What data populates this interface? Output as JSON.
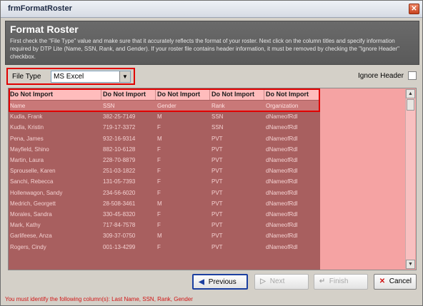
{
  "window": {
    "title": "frmFormatRoster",
    "close_icon": "close-icon"
  },
  "header": {
    "heading": "Format Roster",
    "description": "First check the \"File Type\" value and make sure that it accurately reflects the format of your roster. Next click on the column titles and specify information required by DTP Lite (Name, SSN, Rank, and Gender). If your roster file contains header information, it must be removed by checking the \"Ignore Header\" checkbox."
  },
  "file_type": {
    "label": "File Type",
    "value": "MS Excel"
  },
  "ignore_header": {
    "label": "Ignore Header",
    "checked": false
  },
  "grid": {
    "columns": [
      "Do Not Import",
      "Do Not Import",
      "Do Not Import",
      "Do Not Import",
      "Do Not Import"
    ],
    "rows": [
      [
        "Name",
        "SSN",
        "Gender",
        "Rank",
        "Organization"
      ],
      [
        "Kudla, Frank",
        "382-25-7149",
        "M",
        "SSN",
        "dNameofRdl"
      ],
      [
        "Kudla, Kristin",
        "719-17-3372",
        "F",
        "SSN",
        "dNameofRdl"
      ],
      [
        "Pena, James",
        "932-16-9314",
        "M",
        "PVT",
        "dNameofRdl"
      ],
      [
        "Mayfield, Shino",
        "882-10-6128",
        "F",
        "PVT",
        "dNameofRdl"
      ],
      [
        "Martin, Laura",
        "228-70-8879",
        "F",
        "PVT",
        "dNameofRdl"
      ],
      [
        "Sprouselle, Karen",
        "251-03-1822",
        "F",
        "PVT",
        "dNameofRdl"
      ],
      [
        "Sanchi, Rebecca",
        "131-05-7393",
        "F",
        "PVT",
        "dNameofRdl"
      ],
      [
        "Hollenwagon, Sandy",
        "234-56-6020",
        "F",
        "PVT",
        "dNameofRdl"
      ],
      [
        "Medrich, Georgett",
        "28-508-3461",
        "M",
        "PVT",
        "dNameofRdl"
      ],
      [
        "Morales, Sandra",
        "330-45-8320",
        "F",
        "PVT",
        "dNameofRdl"
      ],
      [
        "Mark, Kathy",
        "717-84-7578",
        "F",
        "PVT",
        "dNameofRdl"
      ],
      [
        "Garlifeese, Anza",
        "309-37-0750",
        "M",
        "PVT",
        "dNameofRdl"
      ],
      [
        "Rogers, Cindy",
        "001-13-4299",
        "F",
        "PVT",
        "dNameofRdl"
      ]
    ]
  },
  "buttons": {
    "previous": "Previous",
    "next": "Next",
    "finish": "Finish",
    "cancel": "Cancel"
  },
  "status": {
    "message": "You must identify the following column(s): Last Name, SSN, Rank, Gender"
  },
  "colors": {
    "grid_bg": "#a85f5f",
    "grid_empty": "#f5a3a3",
    "highlight": "#e00000",
    "status_text": "#d01414"
  }
}
